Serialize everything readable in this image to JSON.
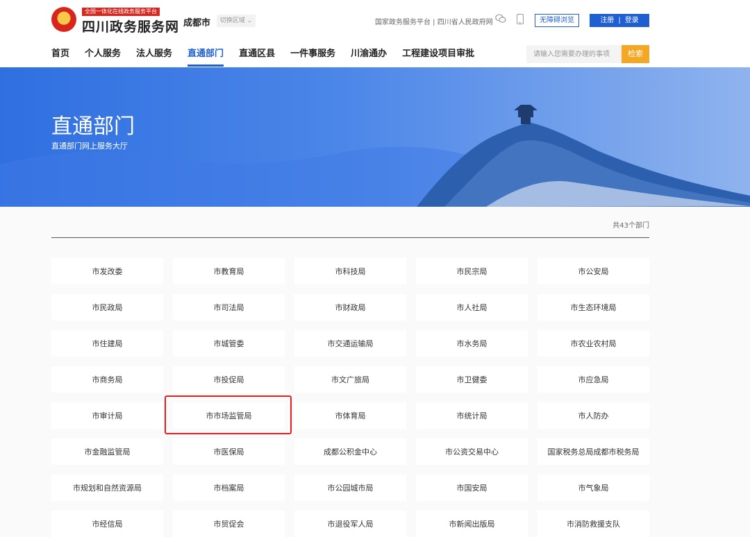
{
  "header": {
    "logo_tag": "全国一体化在线政务服务平台",
    "site_title": "四川政务服务网",
    "city": "成都市",
    "switch_region": "切换区域",
    "top_links": "国家政务服务平台 | 四川省人民政府网",
    "accessibility_label": "无障碍浏览",
    "register_label": "注册",
    "separator": "|",
    "login_label": "登录"
  },
  "nav": {
    "items": [
      "首页",
      "个人服务",
      "法人服务",
      "直通部门",
      "直通区县",
      "一件事服务",
      "川渝通办",
      "工程建设项目审批"
    ],
    "active_index": 3
  },
  "search": {
    "placeholder": "请输入您需要办理的事项",
    "button_label": "检索"
  },
  "banner": {
    "title": "直通部门",
    "subtitle": "直通部门网上服务大厅"
  },
  "department_count": "共43个部门",
  "departments": [
    "市发改委",
    "市教育局",
    "市科技局",
    "市民宗局",
    "市公安局",
    "市民政局",
    "市司法局",
    "市财政局",
    "市人社局",
    "市生态环境局",
    "市住建局",
    "市城管委",
    "市交通运输局",
    "市水务局",
    "市农业农村局",
    "市商务局",
    "市投促局",
    "市文广旅局",
    "市卫健委",
    "市应急局",
    "市审计局",
    "市市场监管局",
    "市体育局",
    "市统计局",
    "市人防办",
    "市金融监管局",
    "市医保局",
    "成都公积金中心",
    "市公资交易中心",
    "国家税务总局成都市税务局",
    "市规划和自然资源局",
    "市档案局",
    "市公园城市局",
    "市国安局",
    "市气象局",
    "市经信局",
    "市贸促会",
    "市退役军人局",
    "市新闻出版局",
    "市消防救援支队"
  ],
  "highlighted_department": "市市场监管局",
  "colors": {
    "brand_blue": "#1f5fd1",
    "search_orange": "#f5a623",
    "emblem_red": "#d9261c",
    "highlight_red": "#e02020"
  }
}
